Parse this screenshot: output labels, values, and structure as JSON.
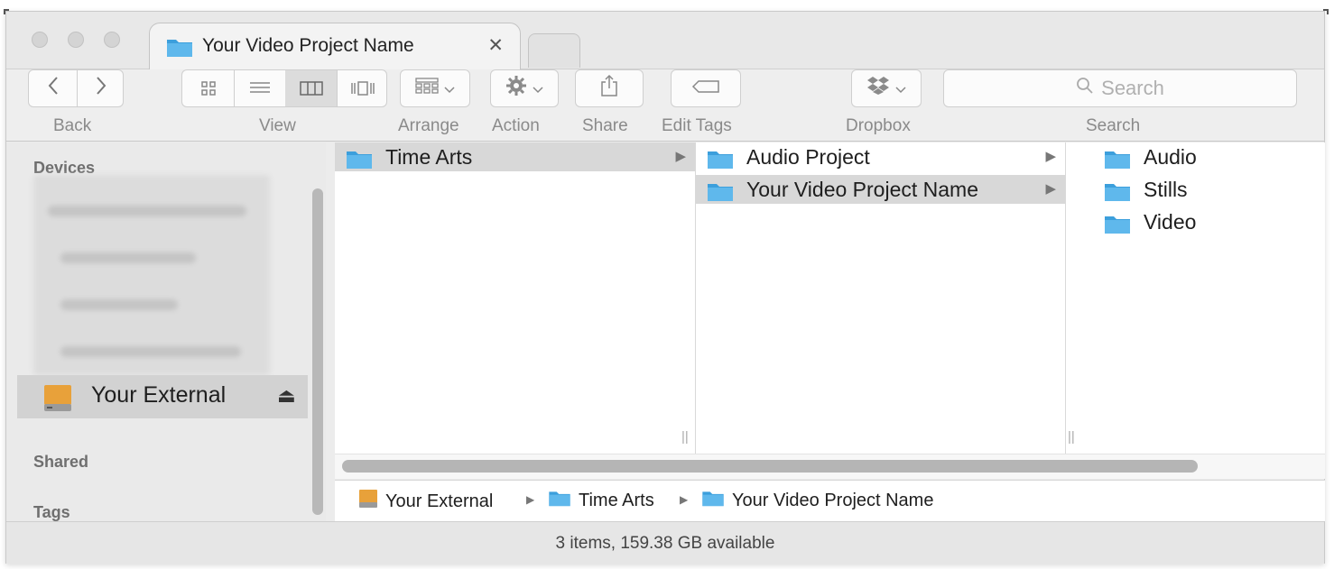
{
  "window": {
    "tab_title": "Your Video Project Name",
    "tab_close": "✕"
  },
  "toolbar": {
    "back_label": "Back",
    "view_label": "View",
    "arrange_label": "Arrange",
    "action_label": "Action",
    "share_label": "Share",
    "edit_tags_label": "Edit Tags",
    "dropbox_label": "Dropbox",
    "search_label": "Search",
    "search_placeholder": "Search"
  },
  "sidebar": {
    "devices_heading": "Devices",
    "selected_device": "Your External",
    "eject_glyph": "⏏",
    "shared_heading": "Shared",
    "tags_heading": "Tags"
  },
  "columns": [
    {
      "items": [
        {
          "label": "Time Arts",
          "selected": true,
          "has_children": true
        }
      ]
    },
    {
      "items": [
        {
          "label": "Audio Project",
          "selected": false,
          "has_children": true
        },
        {
          "label": "Your Video Project Name",
          "selected": true,
          "has_children": true
        }
      ]
    },
    {
      "items": [
        {
          "label": "Audio",
          "selected": false,
          "has_children": false
        },
        {
          "label": "Stills",
          "selected": false,
          "has_children": false
        },
        {
          "label": "Video",
          "selected": false,
          "has_children": false
        }
      ]
    }
  ],
  "pathbar": {
    "crumbs": [
      "Your External",
      "Time Arts",
      "Your Video Project Name"
    ]
  },
  "status": {
    "text": "3 items, 159.38 GB available"
  },
  "colors": {
    "folder_blue": "#5fb8ec",
    "folder_blue_dark": "#3c9fdc",
    "drive_orange": "#e8a13a",
    "selection_gray": "#d8d8d8"
  }
}
